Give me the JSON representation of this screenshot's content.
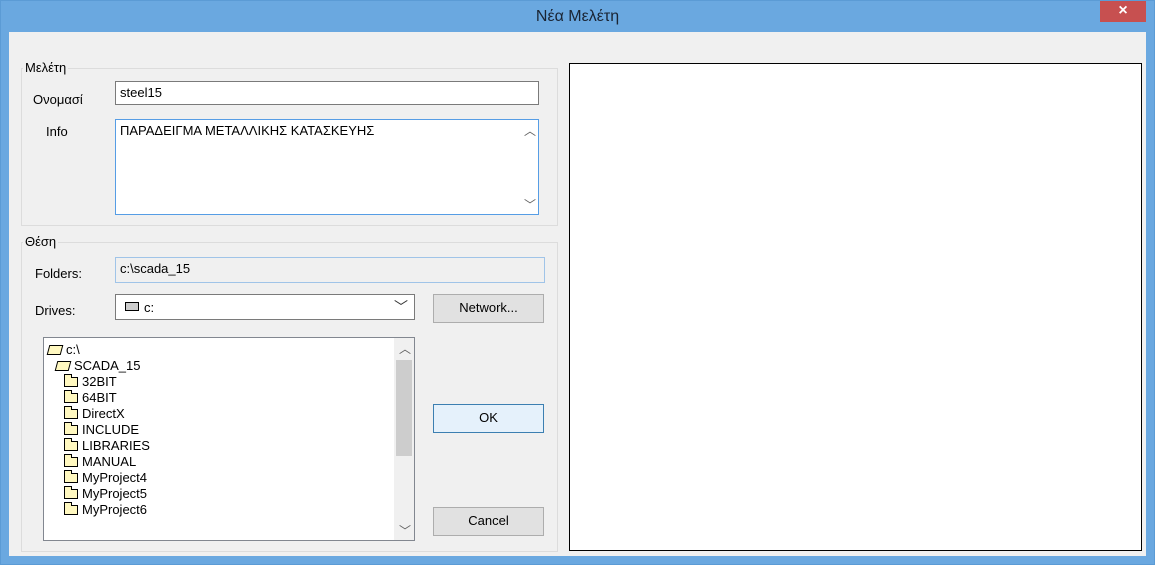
{
  "window": {
    "title": "Νέα Μελέτη",
    "close_symbol": "×"
  },
  "study_group": {
    "label": "Μελέτη",
    "name_label": "Ονομασί",
    "name_value": "steel15",
    "info_label": "Info",
    "info_value": "ΠΑΡΑΔΕΙΓΜΑ ΜΕΤΑΛΛΙΚΗΣ ΚΑΤΑΣΚΕΥΗΣ"
  },
  "location_group": {
    "label": "Θέση",
    "folders_label": "Folders:",
    "folders_value": "c:\\scada_15",
    "drives_label": "Drives:",
    "drive_value": "c:",
    "network_button": "Network...",
    "tree_items": [
      {
        "label": "c:\\",
        "level": 0,
        "icon": "open-folder-icon"
      },
      {
        "label": "SCADA_15",
        "level": 1,
        "icon": "open-folder-icon"
      },
      {
        "label": "32BIT",
        "level": 2,
        "icon": "folder-icon"
      },
      {
        "label": "64BIT",
        "level": 2,
        "icon": "folder-icon"
      },
      {
        "label": "DirectX",
        "level": 2,
        "icon": "folder-icon"
      },
      {
        "label": "INCLUDE",
        "level": 2,
        "icon": "folder-icon"
      },
      {
        "label": "LIBRARIES",
        "level": 2,
        "icon": "folder-icon"
      },
      {
        "label": "MANUAL",
        "level": 2,
        "icon": "folder-icon"
      },
      {
        "label": "MyProject4",
        "level": 2,
        "icon": "folder-icon"
      },
      {
        "label": "MyProject5",
        "level": 2,
        "icon": "folder-icon"
      },
      {
        "label": "MyProject6",
        "level": 2,
        "icon": "folder-icon"
      }
    ]
  },
  "buttons": {
    "ok": "OK",
    "cancel": "Cancel"
  }
}
